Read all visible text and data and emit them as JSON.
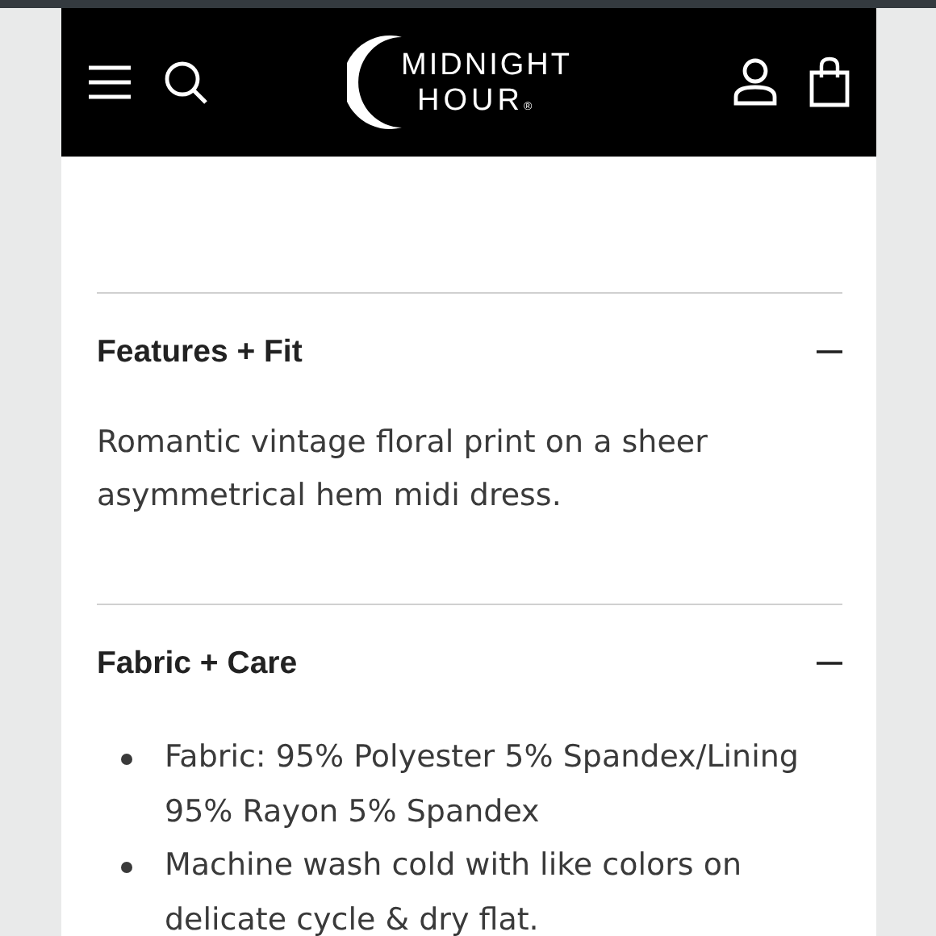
{
  "header": {
    "logo": {
      "line_1": "MIDNIGHT",
      "line_2": "HOUR$_{®}$"
    }
  },
  "sections": [
    {
      "title": "Features + Fit",
      "expanded": true,
      "kind": "paragraph",
      "text": "Romantic vintage floral print on a sheer asymmetrical hem midi dress."
    },
    {
      "title": "Fabric + Care",
      "expanded": true,
      "kind": "list",
      "items": [
        "Fabric: 95% Polyester 5% Spandex/Lining 95% Rayon 5% Spandex",
        "Machine wash cold with like colors on delicate cycle & dry flat."
      ]
    }
  ]
}
